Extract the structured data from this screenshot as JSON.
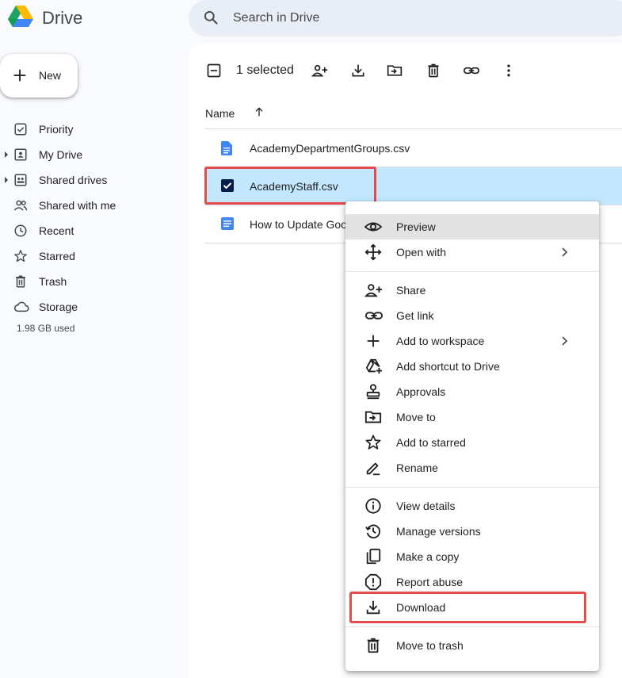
{
  "header": {
    "app_title": "Drive",
    "search_placeholder": "Search in Drive"
  },
  "sidebar": {
    "new_label": "New",
    "items": [
      {
        "label": "Priority",
        "icon": "priority-icon"
      },
      {
        "label": "My Drive",
        "icon": "my-drive-icon"
      },
      {
        "label": "Shared drives",
        "icon": "shared-drives-icon"
      },
      {
        "label": "Shared with me",
        "icon": "shared-with-me-icon"
      },
      {
        "label": "Recent",
        "icon": "clock-icon"
      },
      {
        "label": "Starred",
        "icon": "star-icon"
      },
      {
        "label": "Trash",
        "icon": "trash-icon"
      },
      {
        "label": "Storage",
        "icon": "cloud-icon"
      }
    ],
    "storage_used": "1.98 GB used"
  },
  "toolbar": {
    "selected_text": "1 selected",
    "icons": [
      "deselect-icon",
      "share-icon",
      "download-icon",
      "move-icon",
      "trash-icon",
      "link-icon",
      "more-vert-icon"
    ]
  },
  "list": {
    "column_name": "Name",
    "files": [
      {
        "name": "AcademyDepartmentGroups.csv",
        "icon": "doc-icon",
        "selected": false
      },
      {
        "name": "AcademyStaff.csv",
        "icon": "checkbox-icon",
        "selected": true
      },
      {
        "name": "How to Update Goo",
        "icon": "doc-icon",
        "selected": false
      }
    ]
  },
  "context_menu": {
    "items": [
      {
        "label": "Preview",
        "icon": "eye-icon"
      },
      {
        "label": "Open with",
        "icon": "move-arrows-icon",
        "submenu": true
      },
      {
        "label": "Share",
        "icon": "person-add-icon"
      },
      {
        "label": "Get link",
        "icon": "link-icon"
      },
      {
        "label": "Add to workspace",
        "icon": "plus-icon",
        "submenu": true
      },
      {
        "label": "Add shortcut to Drive",
        "icon": "add-shortcut-icon"
      },
      {
        "label": "Approvals",
        "icon": "approval-stamp-icon"
      },
      {
        "label": "Move to",
        "icon": "folder-move-icon"
      },
      {
        "label": "Add to starred",
        "icon": "star-icon"
      },
      {
        "label": "Rename",
        "icon": "pencil-icon"
      },
      {
        "label": "View details",
        "icon": "info-icon"
      },
      {
        "label": "Manage versions",
        "icon": "history-icon"
      },
      {
        "label": "Make a copy",
        "icon": "copy-icon"
      },
      {
        "label": "Report abuse",
        "icon": "report-icon"
      },
      {
        "label": "Download",
        "icon": "download-icon"
      },
      {
        "label": "Move to trash",
        "icon": "trash-icon"
      }
    ]
  },
  "colors": {
    "selected_row": "#c2e7ff",
    "highlight_box": "#e34c4c",
    "doc_blue": "#4285f4"
  }
}
